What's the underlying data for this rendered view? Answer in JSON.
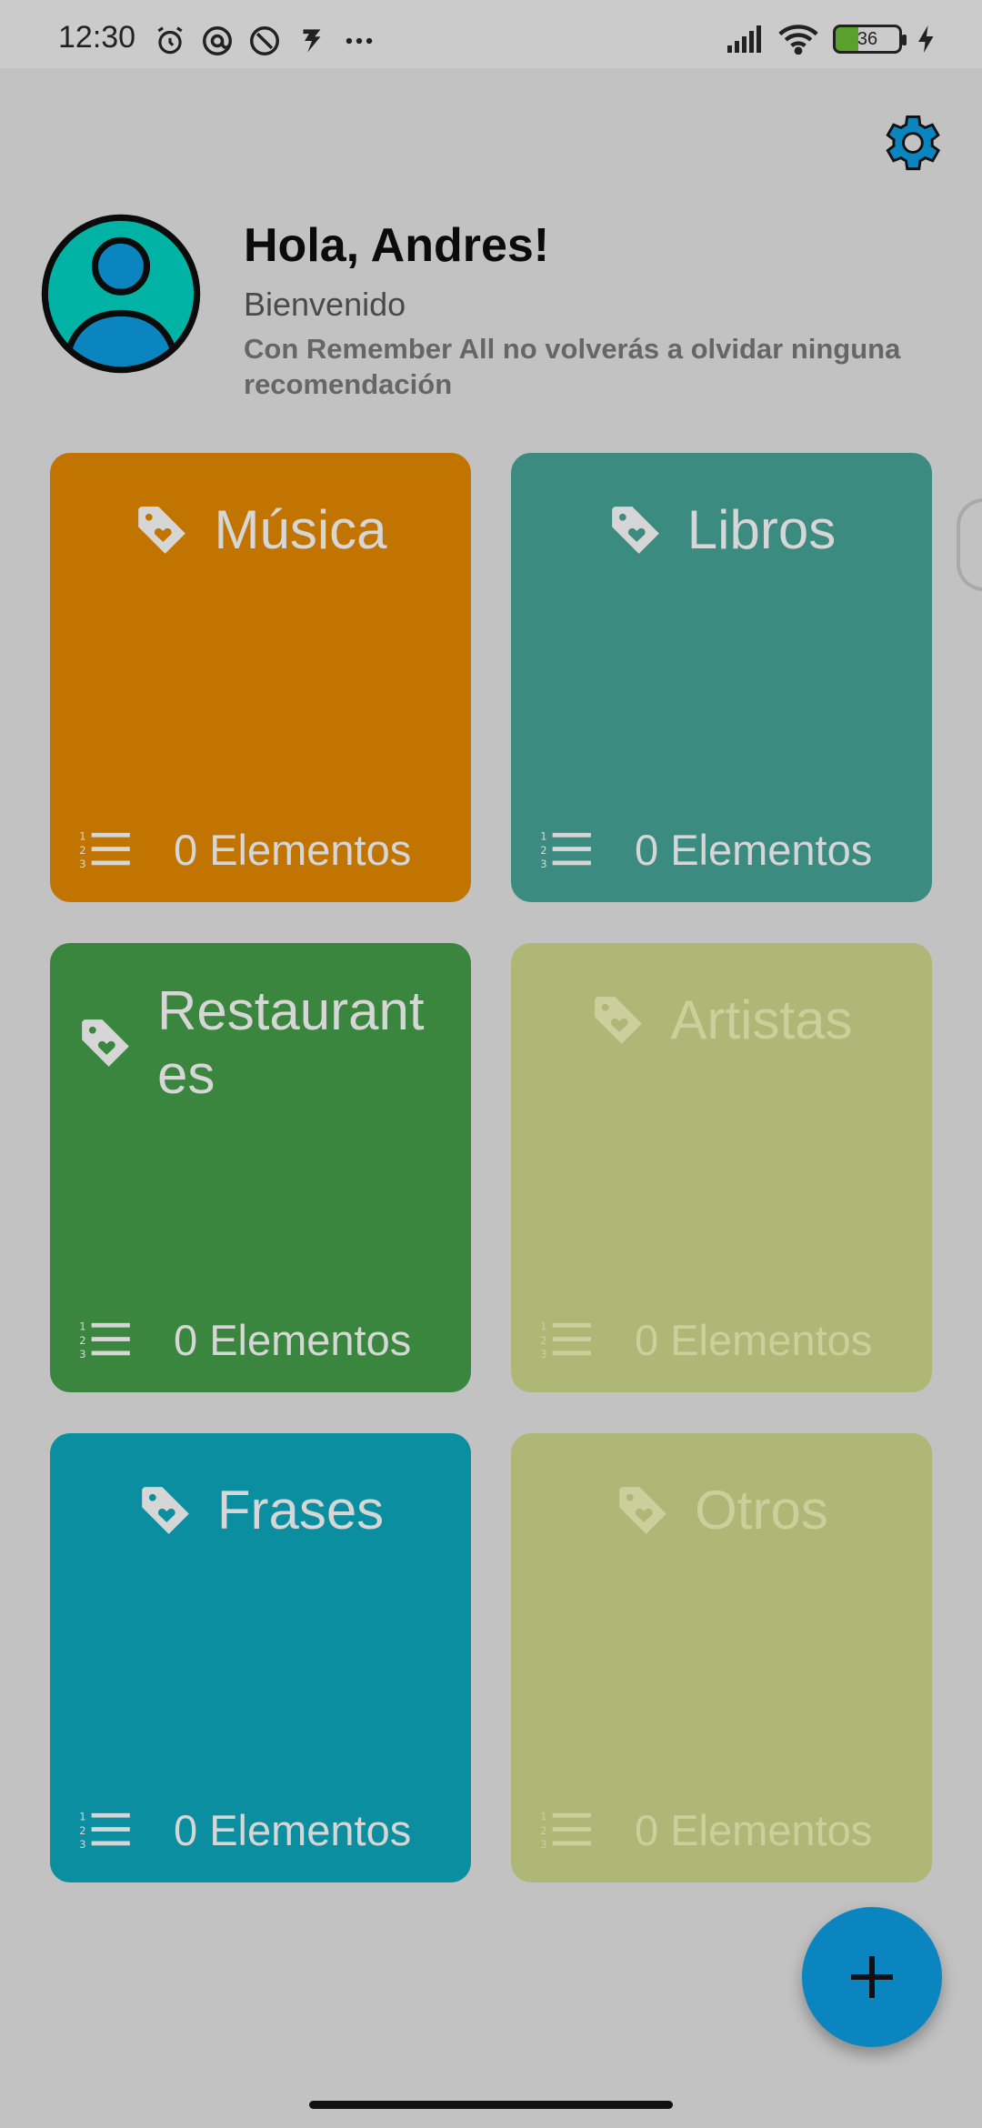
{
  "status_bar": {
    "time": "12:30",
    "battery_level": "36",
    "icons": [
      "alarm-icon",
      "at-sign-icon",
      "at-sign-icon",
      "notification-icon",
      "more-dots-icon",
      "signal-icon",
      "wifi-icon",
      "battery-icon",
      "charging-icon"
    ]
  },
  "header": {
    "greeting": "Hola, Andres!",
    "welcome": "Bienvenido",
    "tagline": "Con Remember All no volverás a olvidar ninguna recomendación"
  },
  "categories": [
    {
      "title": "Música",
      "count": "0 Elementos",
      "color": "#c27400"
    },
    {
      "title": "Libros",
      "count": "0 Elementos",
      "color": "#3c8b80"
    },
    {
      "title": "Restaurantes",
      "count": "0 Elementos",
      "color": "#3b863f"
    },
    {
      "title": "Artistas",
      "count": "0 Elementos",
      "color": "#aeb776"
    },
    {
      "title": "Frases",
      "count": "0 Elementos",
      "color": "#0a8ea0"
    },
    {
      "title": "Otros",
      "count": "0 Elementos",
      "color": "#aeb776"
    }
  ],
  "colors": {
    "background": "#c2c2c2",
    "fab": "#0a85c0",
    "avatar_ring": "#00b3a4"
  }
}
